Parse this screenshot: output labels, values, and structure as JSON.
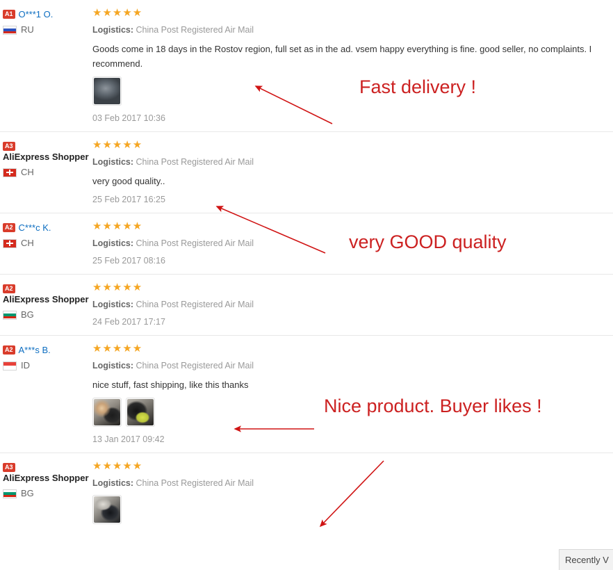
{
  "page": {
    "title": "AliExpress Product Feedback"
  },
  "labels": {
    "logistics_label": "Logistics:",
    "stars_glyphs": "★★★★★"
  },
  "reviews": [
    {
      "rank": "A1",
      "name": "O***1 O.",
      "anonymous": false,
      "country_code": "RU",
      "flag": "flag-ru",
      "stars": "★★★★★",
      "rating": 5,
      "logistics": "China Post Registered Air Mail",
      "text": "Goods come in 18 days in the Rostov region, full set as in the ad. vsem happy everything is fine. good seller, no complaints. I recommend.",
      "photos": [
        "thumb-a"
      ],
      "date": "03 Feb 2017 10:36"
    },
    {
      "rank": "A3",
      "name": "AliExpress Shopper",
      "anonymous": true,
      "country_code": "CH",
      "flag": "flag-ch",
      "stars": "★★★★★",
      "rating": 5,
      "logistics": "China Post Registered Air Mail",
      "text": "very good quality..",
      "photos": [],
      "date": "25 Feb 2017 16:25"
    },
    {
      "rank": "A2",
      "name": "C***c K.",
      "anonymous": false,
      "country_code": "CH",
      "flag": "flag-ch",
      "stars": "★★★★★",
      "rating": 5,
      "logistics": "China Post Registered Air Mail",
      "text": "",
      "photos": [],
      "date": "25 Feb 2017 08:16"
    },
    {
      "rank": "A2",
      "name": "AliExpress Shopper",
      "anonymous": true,
      "country_code": "BG",
      "flag": "flag-bg",
      "stars": "★★★★★",
      "rating": 5,
      "logistics": "China Post Registered Air Mail",
      "text": "",
      "photos": [],
      "date": "24 Feb 2017 17:17"
    },
    {
      "rank": "A2",
      "name": "A***s B.",
      "anonymous": false,
      "country_code": "ID",
      "flag": "flag-id",
      "stars": "★★★★★",
      "rating": 5,
      "logistics": "China Post Registered Air Mail",
      "text": "nice stuff, fast shipping, like this thanks",
      "photos": [
        "thumb-b",
        "thumb-c"
      ],
      "date": "13 Jan 2017 09:42"
    },
    {
      "rank": "A3",
      "name": "AliExpress Shopper",
      "anonymous": true,
      "country_code": "BG",
      "flag": "flag-bg",
      "stars": "★★★★★",
      "rating": 5,
      "logistics": "China Post Registered Air Mail",
      "text": "",
      "photos": [
        "thumb-d"
      ],
      "date": ""
    }
  ],
  "annotations": {
    "color": "#cc2121",
    "texts": [
      {
        "id": "anno-1",
        "text": "Fast delivery !"
      },
      {
        "id": "anno-2",
        "text": "very GOOD quality"
      },
      {
        "id": "anno-3",
        "text": "Nice product. Buyer likes !"
      }
    ]
  },
  "recently_viewed_tab": {
    "label": "Recently V"
  },
  "colors": {
    "rank_badge_bg": "#d93c2b",
    "star": "#f5a623",
    "link": "#0d6ec1",
    "annotation_red": "#cc2121",
    "divider": "#e8e8e8"
  }
}
